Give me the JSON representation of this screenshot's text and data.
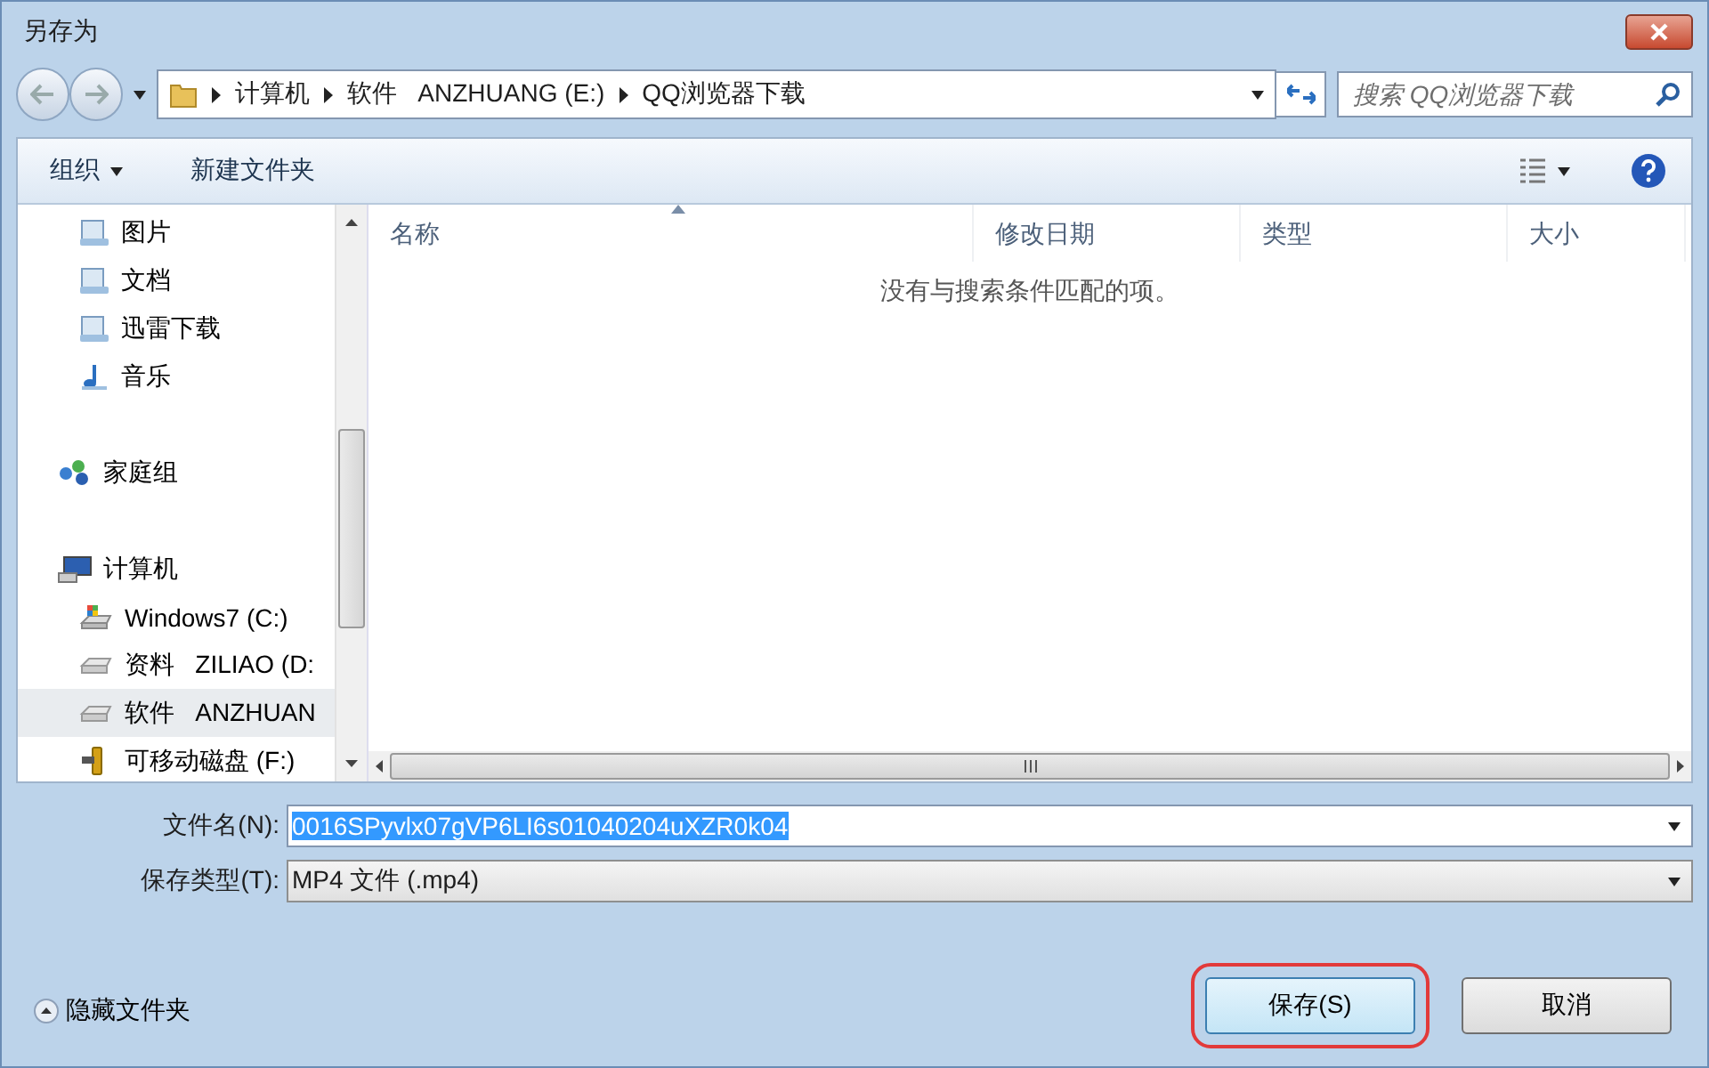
{
  "window": {
    "title": "另存为"
  },
  "address": {
    "segments": [
      "计算机",
      "软件   ANZHUANG (E:)",
      "QQ浏览器下载"
    ]
  },
  "search": {
    "placeholder": "搜索 QQ浏览器下载"
  },
  "toolbar": {
    "organize": "组织",
    "new_folder": "新建文件夹"
  },
  "nav": [
    {
      "label": "图片",
      "kind": "pictures",
      "selected": false
    },
    {
      "label": "文档",
      "kind": "documents",
      "selected": false
    },
    {
      "label": "迅雷下载",
      "kind": "downloads",
      "selected": false
    },
    {
      "label": "音乐",
      "kind": "music",
      "selected": false
    },
    {
      "label": "家庭组",
      "kind": "homegroup",
      "selected": false
    },
    {
      "label": "计算机",
      "kind": "computer",
      "selected": false,
      "children": [
        {
          "label": "Windows7 (C:)",
          "kind": "system-drive",
          "selected": false
        },
        {
          "label": "资料   ZILIAO (D:",
          "kind": "drive",
          "selected": false
        },
        {
          "label": "软件   ANZHUAN",
          "kind": "drive",
          "selected": true
        },
        {
          "label": "可移动磁盘 (F:)",
          "kind": "usb",
          "selected": false
        }
      ]
    }
  ],
  "table": {
    "columns": [
      {
        "label": "名称",
        "sorted": true
      },
      {
        "label": "修改日期",
        "sorted": false
      },
      {
        "label": "类型",
        "sorted": false
      },
      {
        "label": "大小",
        "sorted": false
      }
    ],
    "empty_message": "没有与搜索条件匹配的项。"
  },
  "filename": {
    "label": "文件名(N):",
    "value": "0016SPyvlx07gVP6LI6s01040204uXZR0k04",
    "selected": true
  },
  "filetype": {
    "label": "保存类型(T):",
    "value": "MP4 文件 (.mp4)"
  },
  "hide_folders": "隐藏文件夹",
  "buttons": [
    {
      "label": "保存(S)",
      "highlighted": true
    },
    {
      "label": "取消",
      "highlighted": false
    }
  ]
}
